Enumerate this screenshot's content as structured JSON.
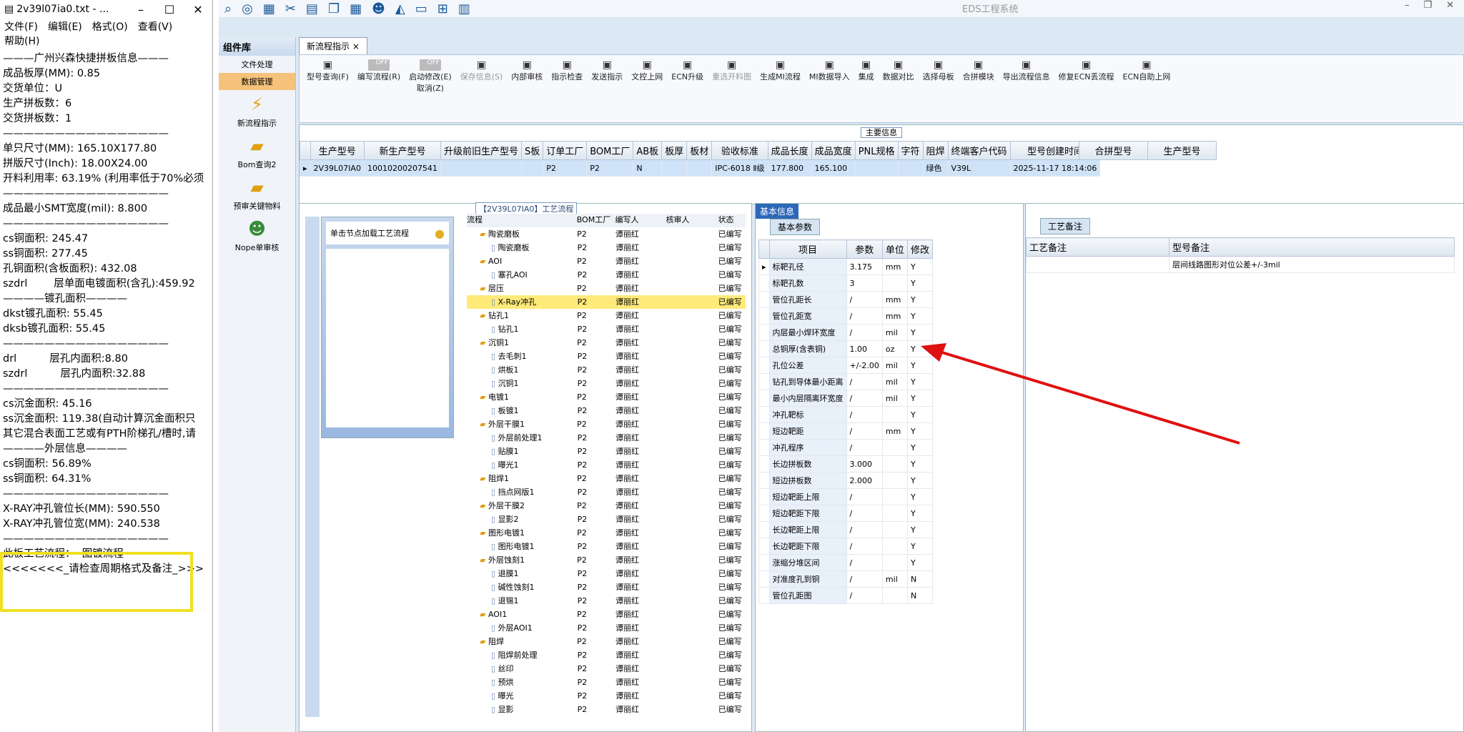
{
  "notepad": {
    "title": "2v39l07ia0.txt - ...",
    "menu": [
      "文件(F)",
      "编辑(E)",
      "格式(O)",
      "查看(V)",
      "帮助(H)"
    ],
    "lines": [
      "———广州兴森快捷拼板信息———",
      "成品板厚(MM): 0.85",
      "交货单位：U",
      "生产拼板数：6",
      "交货拼板数：1",
      "————————————————",
      "单只尺寸(MM): 165.10X177.80",
      "拼版尺寸(Inch): 18.00X24.00",
      "开料利用率: 63.19% (利用率低于70%必须",
      "————————————————",
      "成品最小SMT宽度(mil): 8.800",
      "————————————————",
      "cs铜面积: 245.47",
      "ss铜面积: 277.45",
      "孔铜面积(含板面积): 432.08",
      "szdrl        层单面电镀面积(含孔):459.92",
      "————镀孔面积————",
      "dkst镀孔面积: 55.45",
      "dksb镀孔面积: 55.45",
      "————————————————",
      "drl          层孔内面积:8.80",
      "szdrl          层孔内面积:32.88",
      "————————————————",
      "cs沉金面积: 45.16",
      "ss沉金面积: 119.38(自动计算沉金面积只",
      "其它混合表面工艺或有PTH阶梯孔/槽时,请",
      "————外层信息————",
      "cs铜面积: 56.89%",
      "ss铜面积: 64.31%",
      "————————————————",
      "X-RAY冲孔管位长(MM): 590.550",
      "X-RAY冲孔管位宽(MM): 240.538",
      "————————————————",
      "此板工艺流程：  图镀流程",
      "<<<<<<<_请检查周期格式及备注_>>>"
    ]
  },
  "app": {
    "title": "EDS工程系统",
    "nav": {
      "header": "组件库",
      "items": [
        "文件处理",
        "数据管理",
        "新流程指示",
        "Bom查询2",
        "预审关键物料",
        "Nope单审核"
      ]
    },
    "tab": "新流程指示",
    "toolbar": [
      "型号查询(F)",
      "编写流程(R)",
      "启动修改(E)",
      "保存信息(S)",
      "内部审核",
      "指示检查",
      "发送指示",
      "文控上网",
      "ECN升级",
      "重选开料图",
      "生成MI流程",
      "MI数据导入",
      "集成",
      "数据对比",
      "选择母板",
      "合拼模块",
      "导出流程信息",
      "修复ECN丢流程",
      "ECN自助上网"
    ],
    "toggle_off": "OFF",
    "cancel_label": "取消(Z)",
    "main_info_title": "主要信息",
    "main_cols": [
      "生产型号",
      "新生产型号",
      "升级前旧生产型号",
      "S板",
      "订单工厂",
      "BOM工厂",
      "AB板",
      "板厚",
      "板材",
      "验收标准",
      "成品长度",
      "成品宽度",
      "PNL规格",
      "字符",
      "阻焊",
      "终端客户代码",
      "型号创建时间"
    ],
    "main_row": [
      "2V39L07IA0",
      "10010200207541",
      "",
      "",
      "P2",
      "P2",
      "N",
      "",
      "",
      "IPC-6018 Ⅱ级",
      "177.800",
      "165.100",
      "",
      "",
      "绿色",
      "V39L",
      "2025-11-17 18:14:06"
    ],
    "merge_cols": [
      "合拼型号",
      "生产型号"
    ],
    "proc_title": "【2V39L07IA0】工艺流程",
    "proc_hint": "单击节点加载工艺流程",
    "proc_cols": [
      "流程",
      "BOM工厂",
      "编写人",
      "核审人",
      "状态"
    ],
    "tree": [
      [
        "陶瓷磨板",
        1
      ],
      [
        "陶瓷磨板",
        2
      ],
      [
        "AOI",
        1
      ],
      [
        "塞孔AOI",
        2
      ],
      [
        "层压",
        1
      ],
      [
        "X-Ray冲孔",
        2
      ],
      [
        "钻孔1",
        1
      ],
      [
        "钻孔1",
        2
      ],
      [
        "沉铜1",
        1
      ],
      [
        "去毛刺1",
        2
      ],
      [
        "烘板1",
        2
      ],
      [
        "沉铜1",
        2
      ],
      [
        "电镀1",
        1
      ],
      [
        "板镀1",
        2
      ],
      [
        "外层干膜1",
        1
      ],
      [
        "外层前处理1",
        2
      ],
      [
        "贴膜1",
        2
      ],
      [
        "曝光1",
        2
      ],
      [
        "阻焊1",
        1
      ],
      [
        "挡点网版1",
        2
      ],
      [
        "外层干膜2",
        1
      ],
      [
        "显影2",
        2
      ],
      [
        "图形电镀1",
        1
      ],
      [
        "图形电镀1",
        2
      ],
      [
        "外层蚀刻1",
        1
      ],
      [
        "退膜1",
        2
      ],
      [
        "碱性蚀刻1",
        2
      ],
      [
        "退锡1",
        2
      ],
      [
        "AOI1",
        1
      ],
      [
        "外层AOI1",
        2
      ],
      [
        "阻焊",
        1
      ],
      [
        "阻焊前处理",
        2
      ],
      [
        "丝印",
        2
      ],
      [
        "预烘",
        2
      ],
      [
        "曝光",
        2
      ],
      [
        "显影",
        2
      ]
    ],
    "row_factory": "P2",
    "row_writer": "谭丽红",
    "row_status": "已编写",
    "info_tab": "基本信息",
    "info_sub": "基本参数",
    "info_cols": [
      "项目",
      "参数",
      "单位",
      "修改"
    ],
    "info_rows": [
      [
        "标靶孔径",
        "3.175",
        "mm",
        "Y"
      ],
      [
        "标靶孔数",
        "3",
        "",
        "Y"
      ],
      [
        "管位孔距长",
        "/",
        "mm",
        "Y"
      ],
      [
        "管位孔距宽",
        "/",
        "mm",
        "Y"
      ],
      [
        "内层最小焊环宽度",
        "/",
        "mil",
        "Y"
      ],
      [
        "总铜厚(含表铜)",
        "1.00",
        "oz",
        "Y"
      ],
      [
        "孔位公差",
        "+/-2.00",
        "mil",
        "Y"
      ],
      [
        "钻孔到导体最小距离",
        "/",
        "mil",
        "Y"
      ],
      [
        "最小内层隔离环宽度",
        "/",
        "mil",
        "Y"
      ],
      [
        "冲孔靶标",
        "/",
        "",
        "Y"
      ],
      [
        "短边靶距",
        "/",
        "mm",
        "Y"
      ],
      [
        "冲孔程序",
        "/",
        "",
        "Y"
      ],
      [
        "长边拼板数",
        "3.000",
        "",
        "Y"
      ],
      [
        "短边拼板数",
        "2.000",
        "",
        "Y"
      ],
      [
        "短边靶距上限",
        "/",
        "",
        "Y"
      ],
      [
        "短边靶距下限",
        "/",
        "",
        "Y"
      ],
      [
        "长边靶距上限",
        "/",
        "",
        "Y"
      ],
      [
        "长边靶距下限",
        "/",
        "",
        "Y"
      ],
      [
        "涨缩分堆区间",
        "/",
        "",
        "Y"
      ],
      [
        "对准度孔到铜",
        "/",
        "mil",
        "N"
      ],
      [
        "管位孔距图",
        "/",
        "",
        "N"
      ]
    ],
    "remark_tab": "工艺备注",
    "remark_cols": [
      "工艺备注",
      "型号备注"
    ],
    "remark_text": "层间线路图形对位公差+/-3mil"
  }
}
